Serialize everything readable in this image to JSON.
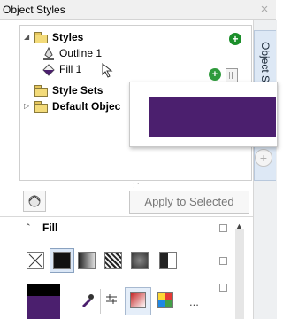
{
  "window": {
    "title": "Object Styles",
    "close_glyph": "×"
  },
  "side_tab": {
    "label": "Object Styles"
  },
  "tree": {
    "items": [
      {
        "label": "Styles",
        "bold": true,
        "icon": "folder-icon"
      },
      {
        "label": "Outline 1",
        "bold": false,
        "icon": "pen-icon"
      },
      {
        "label": "Fill 1",
        "bold": false,
        "icon": "paint-bucket-icon"
      },
      {
        "label": "Style Sets",
        "bold": true,
        "icon": "folder-icon"
      },
      {
        "label": "Default Objec",
        "bold": true,
        "icon": "folder-icon"
      }
    ]
  },
  "preview": {
    "swatch_color": "#4b1f6e"
  },
  "toolbar": {
    "apply_label": "Apply to Selected"
  },
  "fill_section": {
    "title": "Fill",
    "current_fill_color": "#4b1f6e",
    "more_label": "..."
  },
  "colors": {
    "accent_green": "#1b8e2a",
    "fill_purple": "#4b1f6e",
    "tab_blue": "#dde8f5"
  }
}
